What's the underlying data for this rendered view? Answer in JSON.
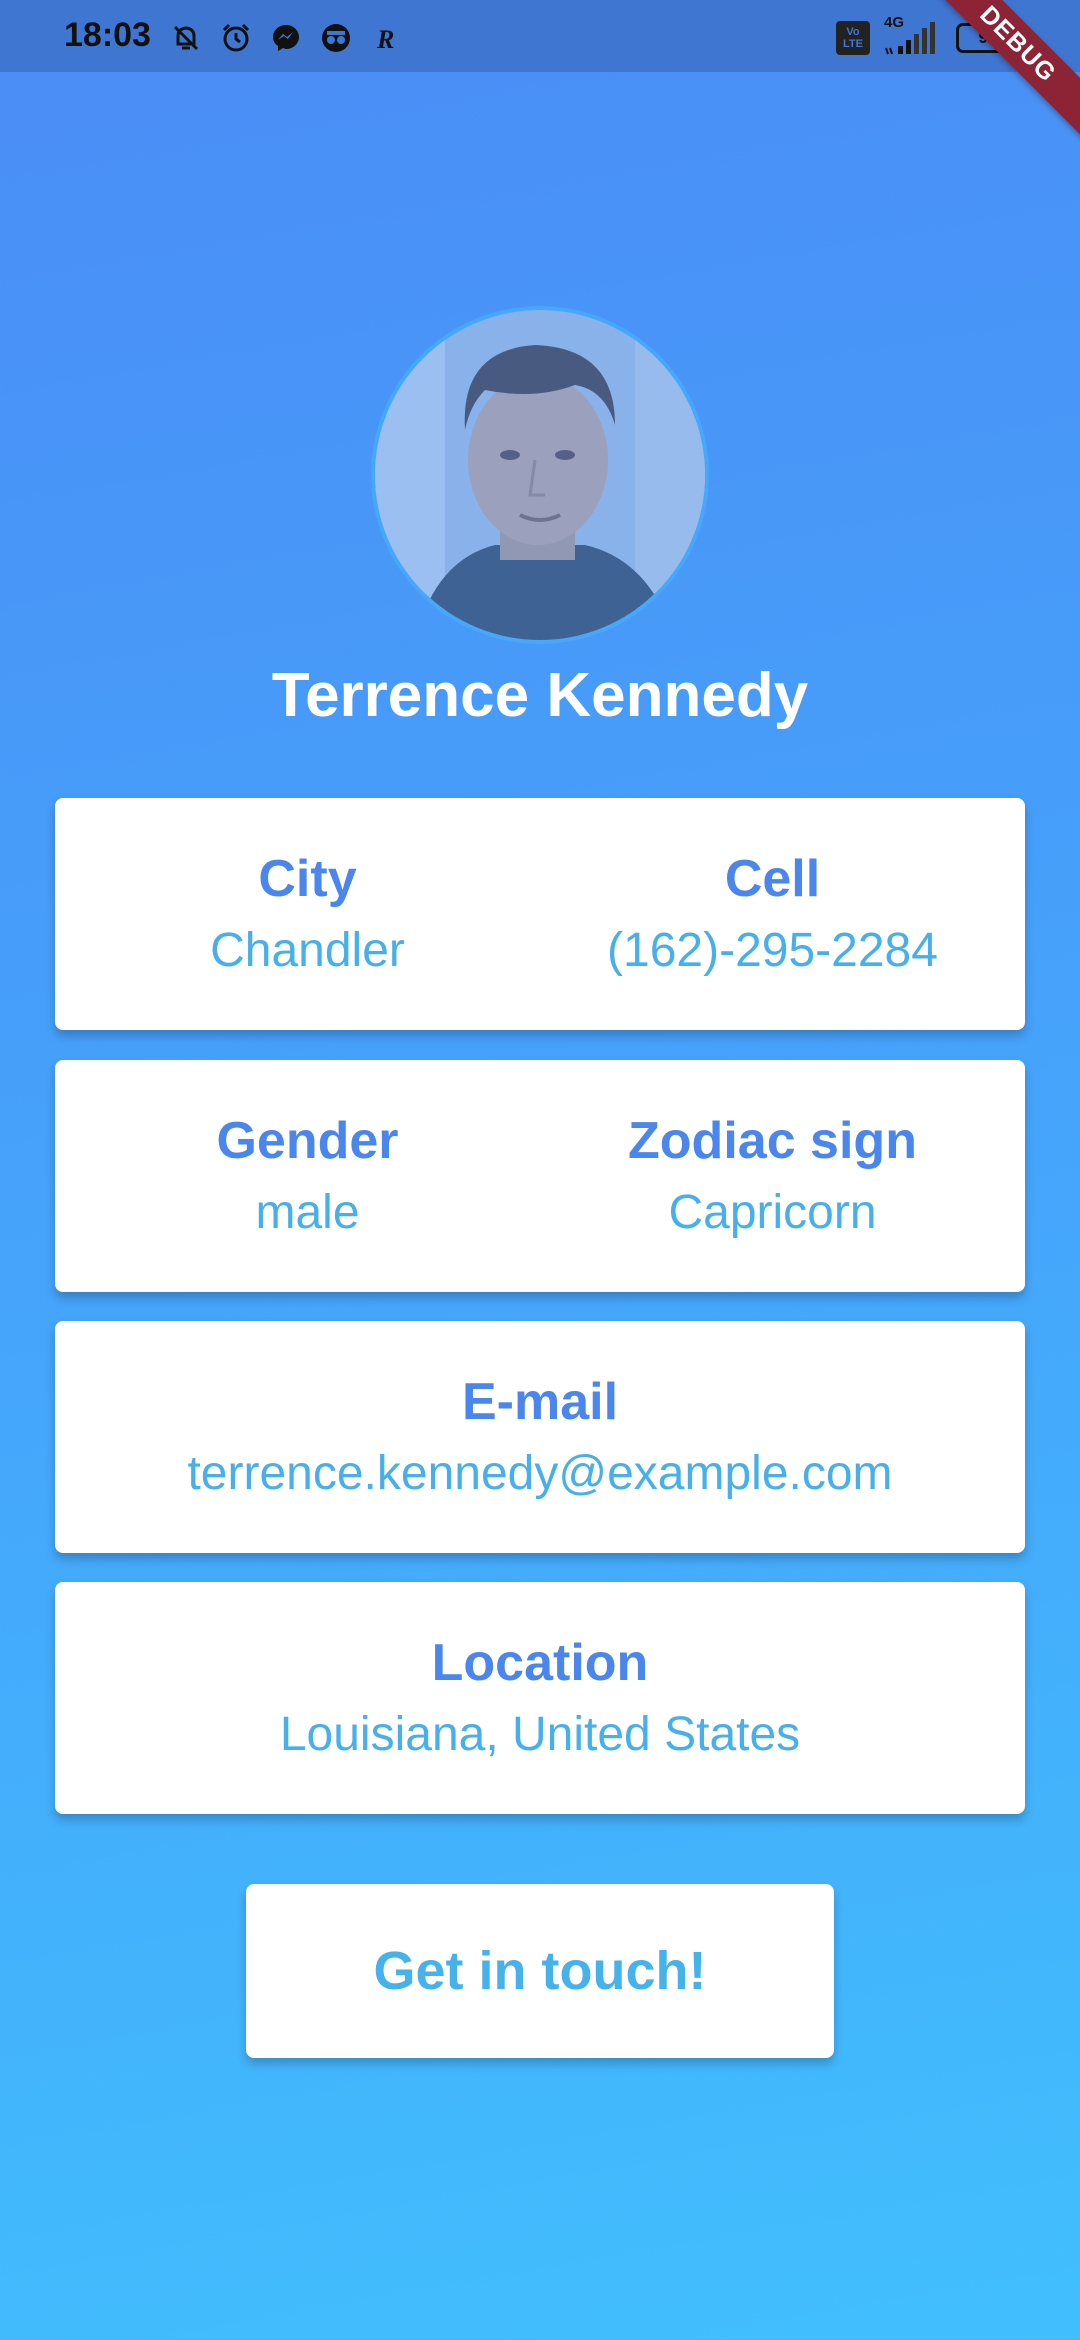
{
  "status_bar": {
    "time": "18:03",
    "left_icons": [
      "bell-muted-icon",
      "alarm-icon",
      "messenger-icon",
      "incognito-icon",
      "r-app-icon"
    ],
    "volte": [
      "Vo",
      "LTE"
    ],
    "network": "4G",
    "battery": "96"
  },
  "debug_banner": "DEBUG",
  "profile": {
    "name": "Terrence Kennedy"
  },
  "cards": {
    "city": {
      "label": "City",
      "value": "Chandler"
    },
    "cell": {
      "label": "Cell",
      "value": "(162)-295-2284"
    },
    "gender": {
      "label": "Gender",
      "value": "male"
    },
    "zodiac": {
      "label": "Zodiac sign",
      "value": "Capricorn"
    },
    "email": {
      "label": "E-mail",
      "value": "terrence.kennedy@example.com"
    },
    "location": {
      "label": "Location",
      "value": "Louisiana, United States"
    }
  },
  "action": {
    "label": "Get in touch!"
  },
  "colors": {
    "bg_top": "#4a8cf6",
    "bg_bottom": "#41bffd",
    "label": "#4a86ec",
    "value": "#47b0ea",
    "ribbon": "#8c2436"
  }
}
